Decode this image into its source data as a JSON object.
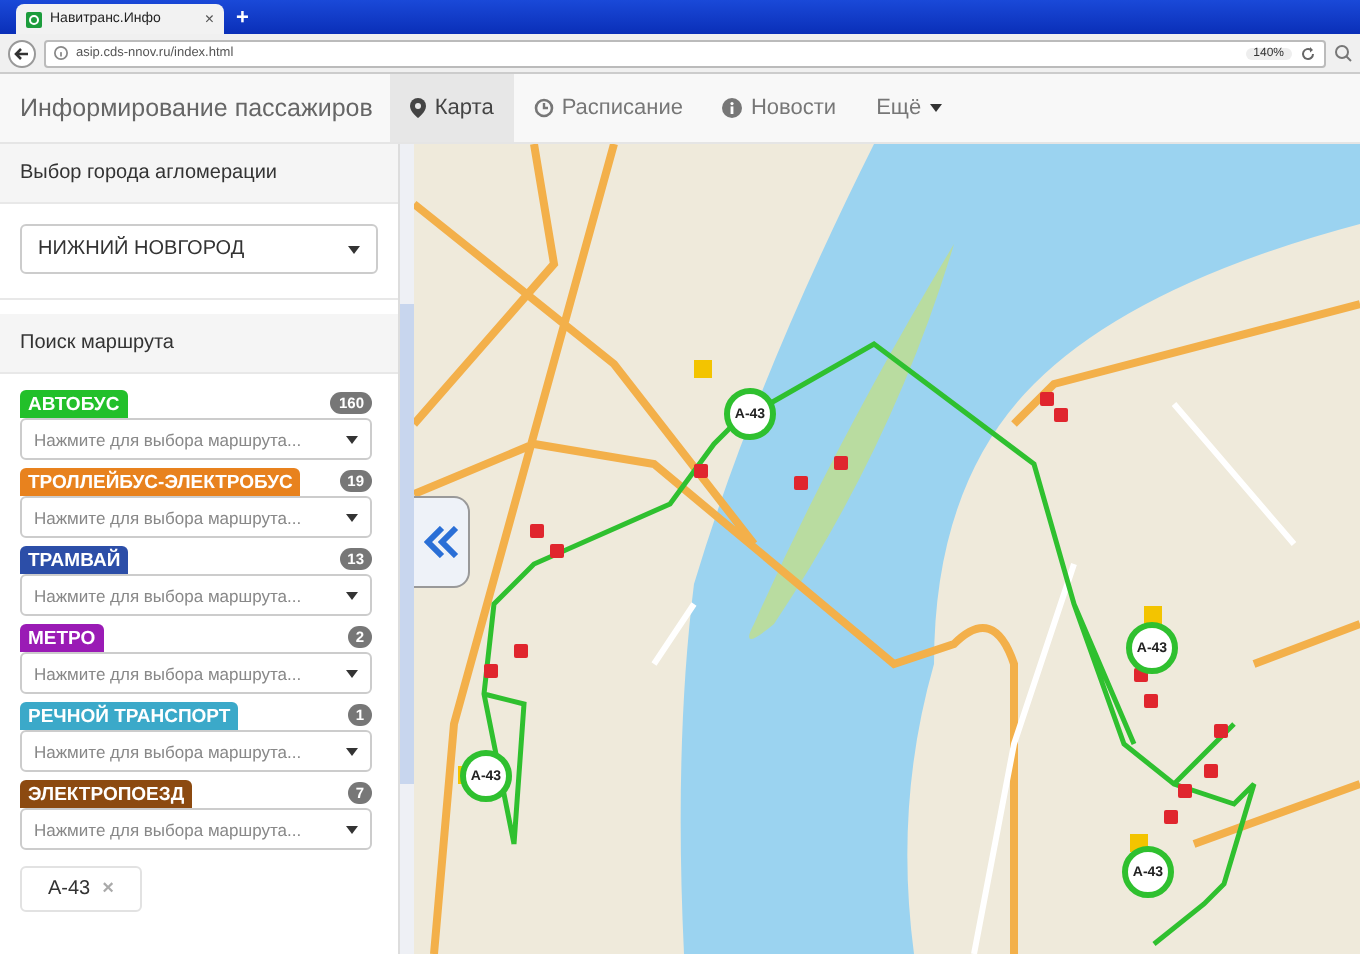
{
  "browser": {
    "tab_title": "Навитранс.Инфо",
    "tab_close": "×",
    "new_tab": "+",
    "url": "asip.cds-nnov.ru/index.html",
    "zoom": "140%"
  },
  "navbar": {
    "brand": "Информирование пассажиров",
    "items": [
      {
        "label": "Карта",
        "kind": "pin",
        "selected": true
      },
      {
        "label": "Расписание",
        "kind": "clock",
        "selected": false
      },
      {
        "label": "Новости",
        "kind": "info",
        "selected": false
      },
      {
        "label": "Ещё",
        "kind": "dropdown",
        "selected": false
      }
    ]
  },
  "sidebar": {
    "city_title": "Выбор города агломерации",
    "city_value": "НИЖНИЙ НОВГОРОД",
    "search_title": "Поиск маршрута",
    "categories": [
      {
        "name": "АВТОБУС",
        "count": "160",
        "color": "#22c02a",
        "placeholder": "Нажмите для выбора маршрута..."
      },
      {
        "name": "ТРОЛЛЕЙБУС-ЭЛЕКТРОБУС",
        "count": "19",
        "color": "#e8821e",
        "placeholder": "Нажмите для выбора маршрута..."
      },
      {
        "name": "ТРАМВАЙ",
        "count": "13",
        "color": "#2c4ea8",
        "placeholder": "Нажмите для выбора маршрута..."
      },
      {
        "name": "МЕТРО",
        "count": "2",
        "color": "#9a1bb5",
        "placeholder": "Нажмите для выбора маршрута..."
      },
      {
        "name": "РЕЧНОЙ ТРАНСПОРТ",
        "count": "1",
        "color": "#3ba9c9",
        "placeholder": "Нажмите для выбора маршрута..."
      },
      {
        "name": "ЭЛЕКТРОПОЕЗД",
        "count": "7",
        "color": "#8c4a10",
        "placeholder": "Нажмите для выбора маршрута..."
      }
    ],
    "chips": [
      {
        "label": "А-43",
        "remove": "×"
      }
    ]
  },
  "map": {
    "markers": [
      {
        "label": "А-43"
      },
      {
        "label": "А-43"
      },
      {
        "label": "А-43"
      },
      {
        "label": "А-43"
      }
    ]
  }
}
